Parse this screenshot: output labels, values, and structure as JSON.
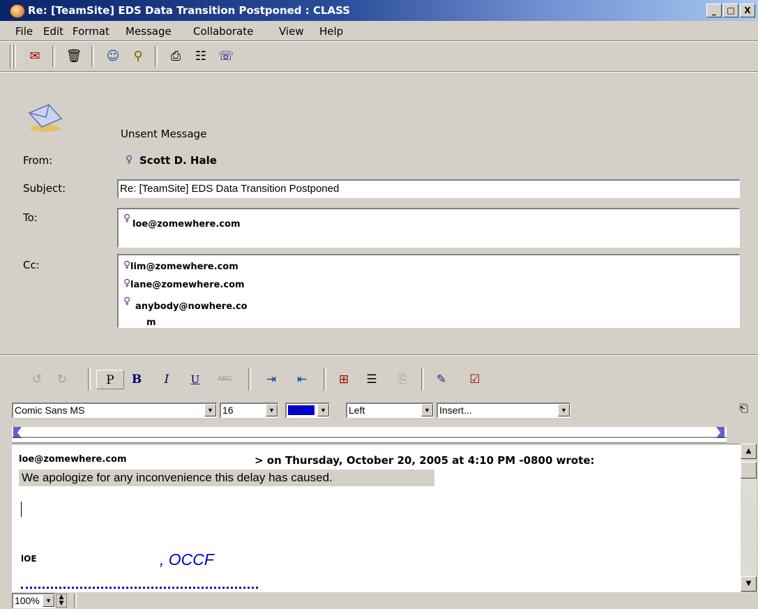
{
  "window": {
    "title": "Re: [TeamSite] EDS Data Transition Postponed : CLASS",
    "minimize": "_",
    "maximize": "□",
    "close": "X"
  },
  "menu": [
    "File",
    "Edit",
    "Format",
    "Message",
    "Collaborate",
    "View",
    "Help"
  ],
  "header": {
    "status": "Unsent Message",
    "from_label": "From:",
    "from_value": "Scott D. Hale",
    "subject_label": "Subject:",
    "subject_value": "Re: [TeamSite] EDS Data Transition Postponed",
    "to_label": "To:",
    "to": [
      "loe@zomewhere.com"
    ],
    "cc_label": "Cc:",
    "cc": [
      "lim@zomewhere.com",
      "lane@zomewhere.com",
      "anybody@nowhere.co",
      "m"
    ]
  },
  "format": {
    "para_label": "P",
    "bold_label": "B",
    "italic_label": "I",
    "underline_label": "U",
    "strike_label": "ABC",
    "font": "Comic Sans MS",
    "size": "16",
    "color": "#0000cc",
    "align": "Left",
    "insert": "Insert..."
  },
  "body": {
    "quote_from": "loe@zomewhere.com",
    "quote_header": "> on Thursday, October 20, 2005 at 4:10 PM -0800 wrote:",
    "quote_text": "We apologize for any inconvenience this delay has caused.",
    "sig_name": "lOE",
    "sig_org": ", OCCF"
  },
  "status": {
    "zoom": "100%"
  }
}
